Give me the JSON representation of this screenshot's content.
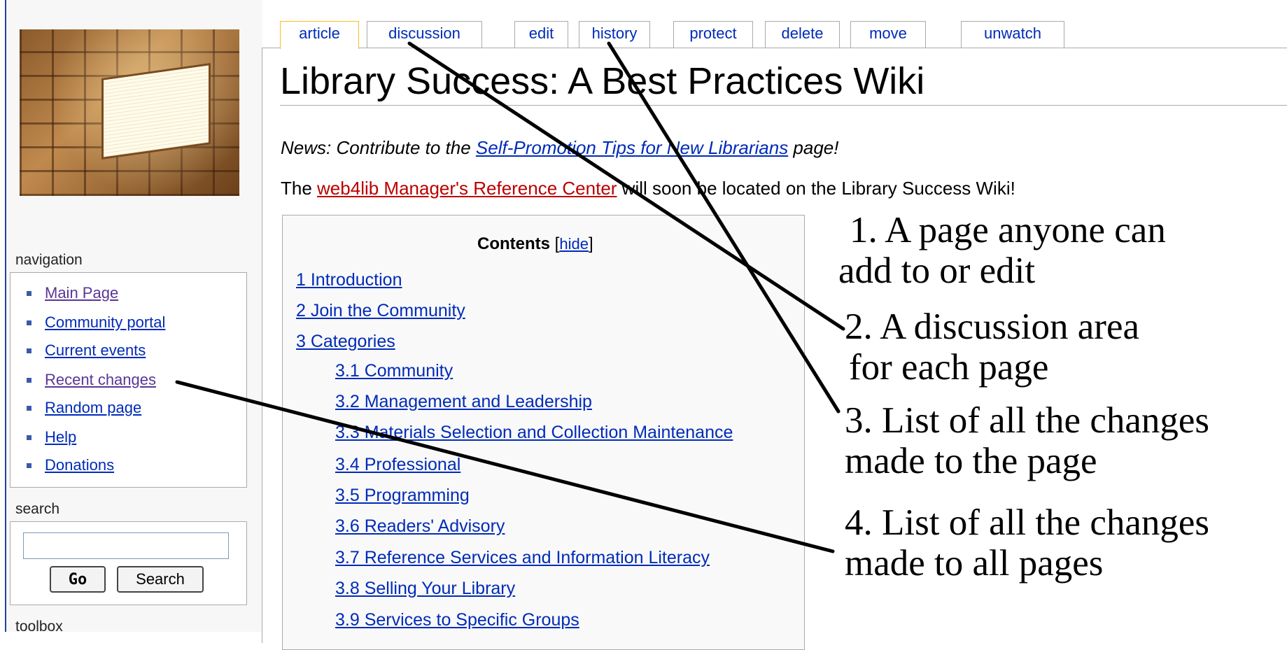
{
  "tabs": [
    {
      "label": "article",
      "selected": true
    },
    {
      "label": "discussion"
    },
    {
      "label": "edit"
    },
    {
      "label": "history"
    },
    {
      "label": "protect"
    },
    {
      "label": "delete"
    },
    {
      "label": "move"
    },
    {
      "label": "unwatch"
    }
  ],
  "page": {
    "title": "Library Success: A Best Practices Wiki",
    "news_prefix": "News: Contribute to the ",
    "news_link": "Self-Promotion Tips for New Librarians",
    "news_suffix": " page!",
    "notice_prefix": "The ",
    "notice_link": "web4lib Manager's Reference Center",
    "notice_suffix": " will soon be located on the Library Success Wiki!"
  },
  "toc": {
    "title": "Contents",
    "hide_open": "[",
    "hide_label": "hide",
    "hide_close": "]",
    "items": [
      "1 Introduction",
      "2 Join the Community",
      "3 Categories",
      "3.1 Community",
      "3.2 Management and Leadership",
      "3.3 Materials Selection and Collection Maintenance",
      "3.4 Professional",
      "3.5 Programming",
      "3.6 Readers' Advisory",
      "3.7 Reference Services and Information Literacy",
      "3.8 Selling Your Library",
      "3.9 Services to Specific Groups"
    ]
  },
  "sidebar": {
    "navigation_title": "navigation",
    "nav_items": [
      "Main Page",
      "Community portal",
      "Current events",
      "Recent changes",
      "Random page",
      "Help",
      "Donations"
    ],
    "search_title": "search",
    "go_label": "Go",
    "search_label": "Search",
    "toolbox_title": "toolbox"
  },
  "annotations": [
    {
      "line1": "1. A page anyone can",
      "line2": "add to or edit"
    },
    {
      "line1": "2. A discussion area",
      "line2": "for each page"
    },
    {
      "line1": "3. List of all the changes",
      "line2": "made to the page"
    },
    {
      "line1": "4. List of all the changes",
      "line2": "made to all pages"
    }
  ],
  "colors": {
    "link": "#002bb8",
    "visited_link": "#5a3696",
    "broken_link": "#ba0000",
    "tab_selected_border": "#fabd23",
    "sidebar_rule": "#2040a0"
  }
}
